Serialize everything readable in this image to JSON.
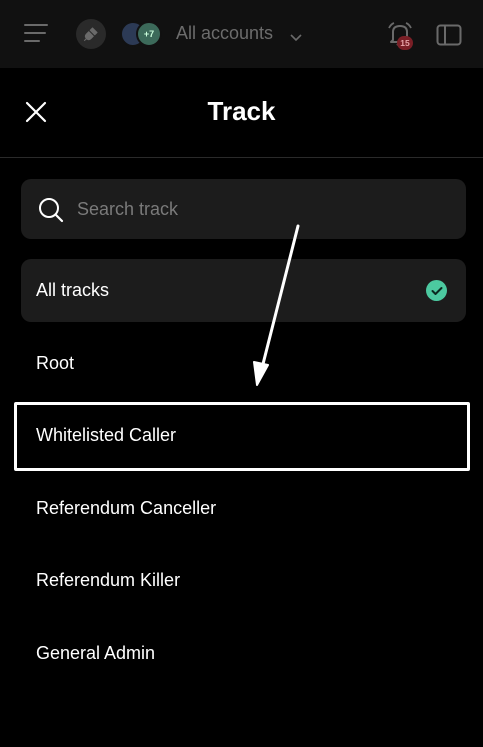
{
  "header": {
    "accounts_label": "All accounts",
    "avatar_badge": "+7",
    "notification_count": "15",
    "icons": [
      "hamburger-icon",
      "plug-icon",
      "chevron-down-icon",
      "bell-icon",
      "sidebar-panel-icon"
    ]
  },
  "sheet": {
    "title": "Track",
    "search_placeholder": "Search track",
    "tracks": [
      {
        "label": "All tracks",
        "selected": true
      },
      {
        "label": "Root",
        "selected": false
      },
      {
        "label": "Whitelisted Caller",
        "selected": false
      },
      {
        "label": "Referendum Canceller",
        "selected": false
      },
      {
        "label": "Referendum Killer",
        "selected": false
      },
      {
        "label": "General Admin",
        "selected": false
      }
    ]
  },
  "colors": {
    "background": "#000000",
    "surface": "#1c1c1c",
    "accent_check": "#4cc9a0",
    "badge": "#7a1f26"
  }
}
